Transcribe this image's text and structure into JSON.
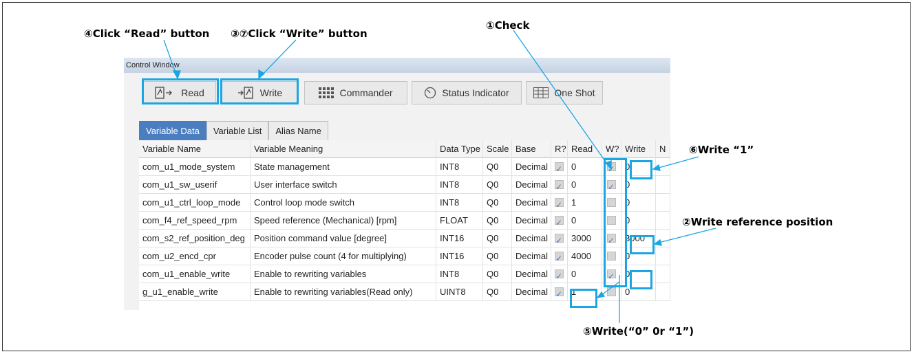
{
  "annotations": {
    "read_click": "④Click “Read” button",
    "write_click": "③⑦Click “Write” button",
    "check": "①Check",
    "write_one": "⑥Write “1”",
    "write_ref": "②Write reference position",
    "write_zero_or_one": "⑤Write(“0” 0r “1”)"
  },
  "window": {
    "title": "Control Window"
  },
  "toolbar": {
    "read_label": "Read",
    "write_label": "Write",
    "commander_label": "Commander",
    "status_label": "Status Indicator",
    "oneshot_label": "One Shot"
  },
  "tabs": [
    "Variable Data",
    "Variable List",
    "Alias Name"
  ],
  "columns": [
    "Variable Name",
    "Variable Meaning",
    "Data Type",
    "Scale",
    "Base",
    "R?",
    "Read",
    "W?",
    "Write",
    "N"
  ],
  "rows": [
    {
      "name": "com_u1_mode_system",
      "meaning": "State management",
      "type": "INT8",
      "scale": "Q0",
      "base": "Decimal",
      "read": "0",
      "w": true,
      "write": "0"
    },
    {
      "name": "com_u1_sw_userif",
      "meaning": "User interface switch",
      "type": "INT8",
      "scale": "Q0",
      "base": "Decimal",
      "read": "0",
      "w": true,
      "write": "0"
    },
    {
      "name": "com_u1_ctrl_loop_mode",
      "meaning": "Control loop mode switch",
      "type": "INT8",
      "scale": "Q0",
      "base": "Decimal",
      "read": "1",
      "w": false,
      "write": "0"
    },
    {
      "name": "com_f4_ref_speed_rpm",
      "meaning": "Speed reference (Mechanical)  [rpm]",
      "type": "FLOAT",
      "scale": "Q0",
      "base": "Decimal",
      "read": "0",
      "w": false,
      "write": "0"
    },
    {
      "name": "com_s2_ref_position_deg",
      "meaning": "Position command value  [degree]",
      "type": "INT16",
      "scale": "Q0",
      "base": "Decimal",
      "read": "3000",
      "w": true,
      "write": "3000"
    },
    {
      "name": "com_u2_encd_cpr",
      "meaning": "Encoder pulse count (4 for multiplying)",
      "type": "INT16",
      "scale": "Q0",
      "base": "Decimal",
      "read": "4000",
      "w": false,
      "write": "0"
    },
    {
      "name": "com_u1_enable_write",
      "meaning": "Enable to rewriting variables",
      "type": "INT8",
      "scale": "Q0",
      "base": "Decimal",
      "read": "0",
      "w": true,
      "write": "0"
    },
    {
      "name": "g_u1_enable_write",
      "meaning": "Enable to rewriting variables(Read only)",
      "type": "UINT8",
      "scale": "Q0",
      "base": "Decimal",
      "read": "1",
      "w": false,
      "write": "0"
    }
  ],
  "colors": {
    "highlight": "#1aa6e3",
    "tab_active": "#4a7ec0"
  }
}
